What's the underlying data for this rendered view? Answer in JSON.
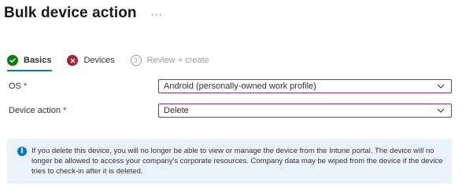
{
  "header": {
    "title": "Bulk device action",
    "more_label": "···"
  },
  "steps": [
    {
      "label": "Basics",
      "status": "complete",
      "icon": "check-icon"
    },
    {
      "label": "Devices",
      "status": "error",
      "icon": "error-icon"
    },
    {
      "label": "Review + create",
      "status": "not-started",
      "number": "3"
    }
  ],
  "form": {
    "os": {
      "label": "OS",
      "required_mark": "*",
      "value": "Android (personally-owned work profile)"
    },
    "device_action": {
      "label": "Device action",
      "required_mark": "*",
      "value": "Delete"
    }
  },
  "info_banner": {
    "icon": "info-icon",
    "text": "If you delete this device, you will no longer be able to view or manage the device from the Intune portal. The device will no longer be allowed to access your company's corporate resources. Company data may be wiped from the device if the device tries to check-in after it is deleted."
  },
  "colors": {
    "accent": "#0078d4",
    "success": "#107c10",
    "error": "#a4262c",
    "input_border": "#8a2f83",
    "info_background": "#eaf3fb"
  }
}
